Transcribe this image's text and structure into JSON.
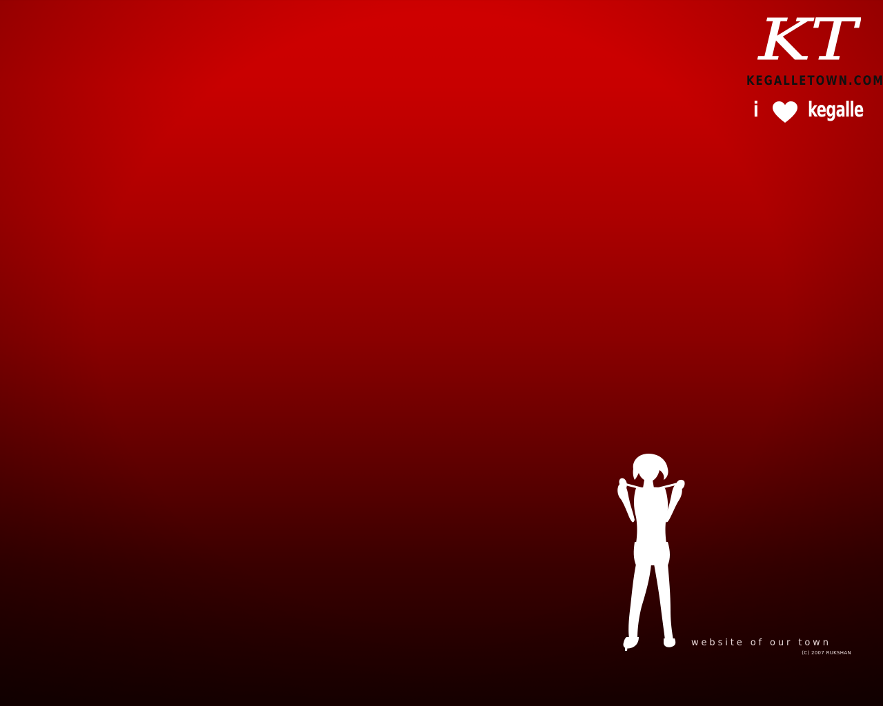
{
  "logo": {
    "monogram": "KT",
    "site_name": "KEGALLETOWN.COM"
  },
  "love_banner": {
    "prefix": "i",
    "heart_icon": "heart-icon",
    "town": "kegalle"
  },
  "footer": {
    "tagline": "website of our town",
    "copyright": "(C) 2007 RUKSHAN"
  },
  "colors": {
    "background_top": "#d00000",
    "background_bottom": "#180000",
    "silhouette": "#ffffff",
    "site_name": "#111111"
  },
  "illustration": {
    "icon": "woman-silhouette-icon"
  }
}
